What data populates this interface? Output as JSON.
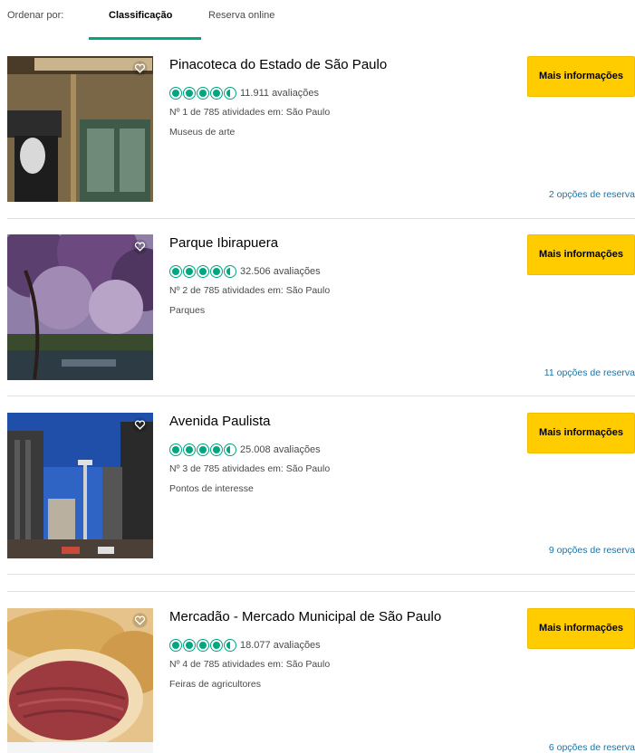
{
  "sort": {
    "label": "Ordenar por:",
    "tabs": [
      "Classificação",
      "Reserva online"
    ]
  },
  "listings": [
    {
      "title": "Pinacoteca do Estado de São Paulo",
      "rating": 4.5,
      "reviews": "11.911 avaliações",
      "rank": "Nº 1 de 785 atividades em: São Paulo",
      "category": "Museus de arte",
      "button": "Mais informações",
      "booking": "2 opções de reserva"
    },
    {
      "title": "Parque Ibirapuera",
      "rating": 4.5,
      "reviews": "32.506 avaliações",
      "rank": "Nº 2 de 785 atividades em: São Paulo",
      "category": "Parques",
      "button": "Mais informações",
      "booking": "11 opções de reserva"
    },
    {
      "title": "Avenida Paulista",
      "rating": 4.5,
      "reviews": "25.008 avaliações",
      "rank": "Nº 3 de 785 atividades em: São Paulo",
      "category": "Pontos de interesse",
      "button": "Mais informações",
      "booking": "9 opções de reserva"
    },
    {
      "title": "Mercadão - Mercado Municipal de São Paulo",
      "rating": 4.5,
      "reviews": "18.077 avaliações",
      "rank": "Nº 4 de 785 atividades em: São Paulo",
      "category": "Feiras de agricultores",
      "button": "Mais informações",
      "booking": "6 opções de reserva"
    }
  ],
  "colors": {
    "accent": "#00a680",
    "button": "#ffcc00",
    "link": "#1a73a8"
  }
}
